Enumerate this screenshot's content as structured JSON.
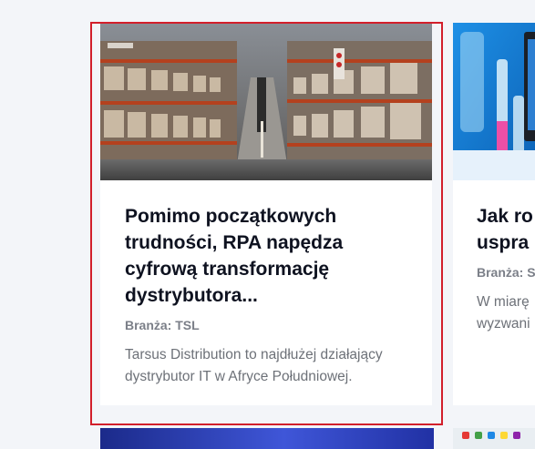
{
  "cards": [
    {
      "title": "Pomimo początkowych trudności, RPA napędza cyfrową transformację dystrybutora...",
      "meta_label": "Branża:",
      "meta_value": "TSL",
      "excerpt": "Tarsus Distribution to najdłużej działający dystrybutor IT w Afryce Południowej.",
      "image": "warehouse-aisle-photo"
    },
    {
      "title_line1": "Jak ro",
      "title_line2": "uspra",
      "meta_label": "Branża: S",
      "excerpt_line1": "W miarę",
      "excerpt_line2": "wyzwani",
      "image": "laboratory-tablet-photo"
    }
  ],
  "colors": {
    "highlight_border": "#d21f2b",
    "title": "#0e1220",
    "meta": "#7b7f88",
    "excerpt": "#6d7178",
    "page_bg": "#f3f5f9"
  }
}
